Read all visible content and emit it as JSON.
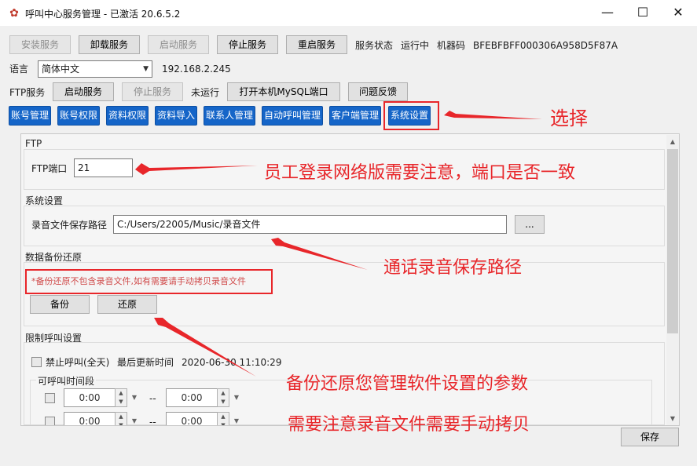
{
  "window": {
    "title": "呼叫中心服务管理 - 已激活  20.6.5.2",
    "icon": "gear-app-icon"
  },
  "service_row": {
    "install": "安装服务",
    "uninstall": "卸载服务",
    "start": "启动服务",
    "stop": "停止服务",
    "restart": "重启服务",
    "status_label": "服务状态",
    "status_value": "运行中",
    "machine_label": "机器码",
    "machine_code": "BFEBFBFF000306A958D5F87A"
  },
  "lang_row": {
    "label": "语言",
    "selected": "简体中文",
    "ip": "192.168.2.245"
  },
  "ftp_row": {
    "label": "FTP服务",
    "start": "启动服务",
    "stop": "停止服务",
    "status": "未运行",
    "open_mysql": "打开本机MySQL端口",
    "feedback": "问题反馈"
  },
  "tabs": [
    "账号管理",
    "账号权限",
    "资料权限",
    "资料导入",
    "联系人管理",
    "自动呼叫管理",
    "客户端管理",
    "系统设置"
  ],
  "ftp_group": {
    "title": "FTP",
    "port_label": "FTP端口",
    "port_value": "21"
  },
  "system_group": {
    "title": "系统设置",
    "path_label": "录音文件保存路径",
    "path_value": "C:/Users/22005/Music/录音文件",
    "browse": "..."
  },
  "backup_group": {
    "title": "数据备份还原",
    "note": "*备份还原不包含录音文件,如有需要请手动拷贝录音文件",
    "backup": "备份",
    "restore": "还原"
  },
  "limit_group": {
    "title": "限制呼叫设置",
    "ban_label": "禁止呼叫(全天)",
    "updated_label": "最后更新时间",
    "updated_value": "2020-06-30 11:10:29",
    "period_title": "可呼叫时间段",
    "periods": [
      {
        "start": "0:00",
        "sep": "--",
        "end": "0:00"
      },
      {
        "start": "0:00",
        "sep": "--",
        "end": "0:00"
      }
    ]
  },
  "save": "保存",
  "annotations": {
    "select": "选择",
    "port_note": "员工登录网络版需要注意，端口是否一致",
    "path_note": "通话录音保存路径",
    "backup_note": "备份还原您管理软件设置的参数",
    "copy_note": "需要注意录音文件需要手动拷贝"
  },
  "colors": {
    "tab_blue": "#1565c8",
    "annotation_red": "#e8262a"
  }
}
